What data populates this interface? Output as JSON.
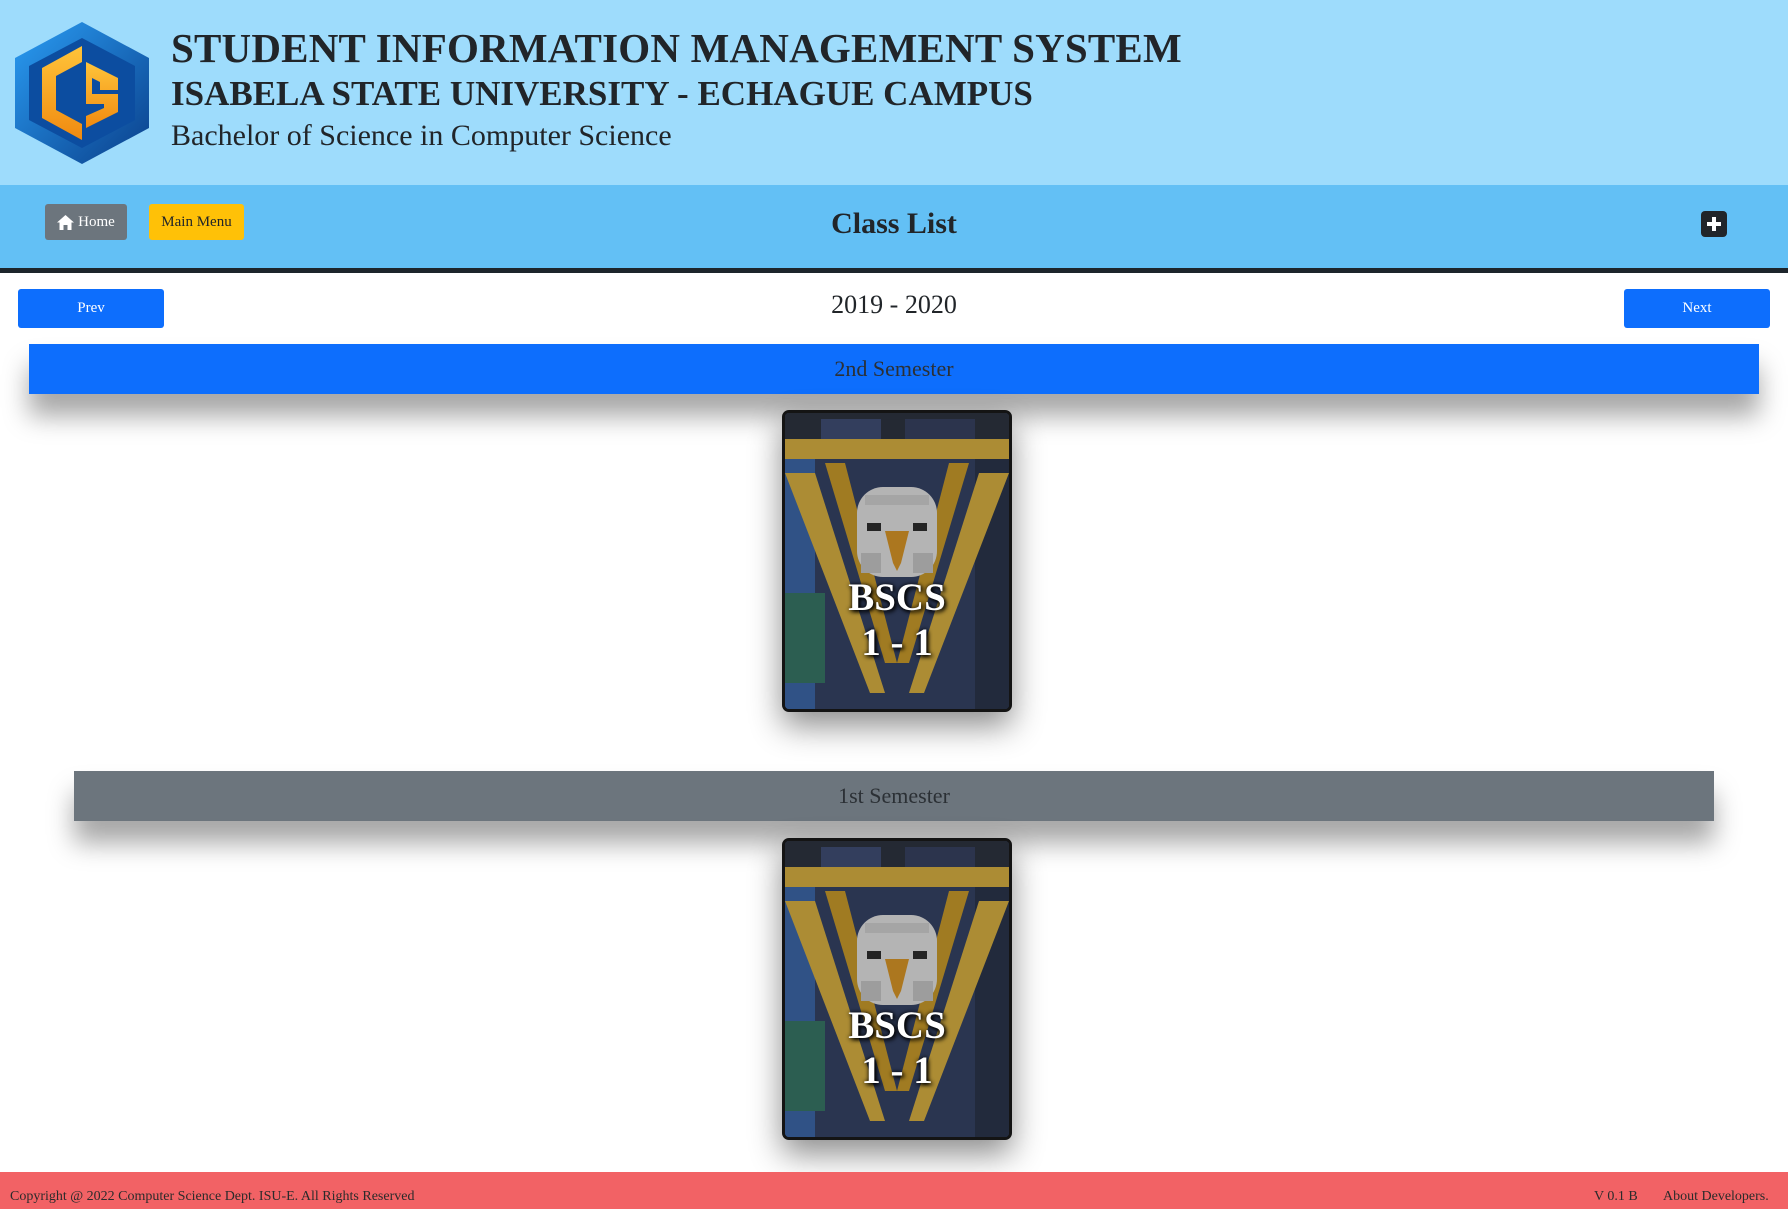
{
  "header": {
    "title": "STUDENT INFORMATION MANAGEMENT SYSTEM",
    "university": "ISABELA STATE UNIVERSITY - ECHAGUE CAMPUS",
    "program": "Bachelor of Science in Computer Science",
    "logo_icon": "cs-hexagon-logo"
  },
  "nav": {
    "home_label": "Home",
    "home_icon": "home-icon",
    "main_menu_label": "Main Menu",
    "page_title": "Class List",
    "add_icon": "plus-square-icon"
  },
  "pager": {
    "prev_label": "Prev",
    "next_label": "Next",
    "year": "2019 - 2020"
  },
  "semesters": [
    {
      "label": "2nd Semester",
      "color": "#0d6efd",
      "classes": [
        {
          "course": "BSCS",
          "section": "1 - 1"
        }
      ]
    },
    {
      "label": "1st Semester",
      "color": "#6c757d",
      "classes": [
        {
          "course": "BSCS",
          "section": "1 - 1"
        }
      ]
    }
  ],
  "footer": {
    "copyright": "Copyright @ 2022 Computer Science Dept. ISU-E. All Rights Reserved",
    "version": "V 0.1 B",
    "about": "About Developers."
  },
  "colors": {
    "header_bg": "#9edcfc",
    "nav_bg": "#63c0f5",
    "primary": "#0d6efd",
    "secondary": "#6c757d",
    "warning": "#ffc107",
    "footer_bg": "#f26265"
  }
}
